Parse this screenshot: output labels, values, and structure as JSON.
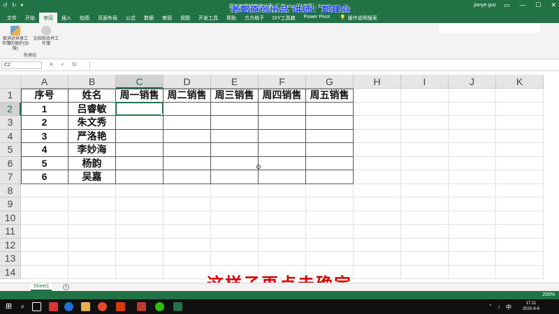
{
  "window": {
    "title": "周五每周销售统计表_汇总.xlsx [已共享] - Excel",
    "watermark": "老郭原创出品   讲师：郭建业",
    "user": "jianye guo",
    "quick_access": [
      "↺",
      "↻",
      "▾"
    ],
    "controls": [
      "▭",
      "—",
      "☐",
      "✕"
    ]
  },
  "ribbon": {
    "tabs": [
      "文件",
      "开始",
      "审阅",
      "插入",
      "绘图",
      "页面布局",
      "公式",
      "数据",
      "审阅",
      "视图",
      "开发工具",
      "帮助",
      "方方格子",
      "DIY工具箱",
      "Power Pivot"
    ],
    "active_tab_index": 2,
    "tell_me": "操作说明搜索",
    "buttons": [
      {
        "label": "取消对共享工作簿的保护(旧版)"
      },
      {
        "label": "比较和合并工作簿"
      }
    ],
    "group_label": "新建组"
  },
  "formula_bar": {
    "name_box": "C2",
    "buttons": [
      "✕",
      "✓",
      "fx"
    ],
    "value": ""
  },
  "sheet": {
    "columns": [
      "A",
      "B",
      "C",
      "D",
      "E",
      "F",
      "G",
      "H",
      "I",
      "J",
      "K"
    ],
    "rows": [
      "1",
      "2",
      "3",
      "4",
      "5",
      "6",
      "7",
      "8",
      "9",
      "10",
      "11",
      "12",
      "13",
      "14"
    ],
    "selected_cell": "C2",
    "header_row": [
      "序号",
      "姓名",
      "周一销售",
      "周二销售",
      "周三销售",
      "周四销售",
      "周五销售"
    ],
    "data_rows": [
      [
        "1",
        "吕睿敏",
        "",
        "",
        "",
        "",
        ""
      ],
      [
        "2",
        "朱文秀",
        "",
        "",
        "",
        "",
        ""
      ],
      [
        "3",
        "严洛艳",
        "",
        "",
        "",
        "",
        ""
      ],
      [
        "4",
        "李妙海",
        "",
        "",
        "",
        "",
        ""
      ],
      [
        "5",
        "杨韵",
        "",
        "",
        "",
        "",
        ""
      ],
      [
        "6",
        "吴嘉",
        "",
        "",
        "",
        "",
        ""
      ]
    ]
  },
  "sheet_tabs": {
    "tabs": [
      "Sheet1"
    ],
    "add": "+"
  },
  "subtitle": "这样子再点击确定",
  "status_bar": {
    "zoom": "205%"
  },
  "taskbar": {
    "ime": "中",
    "time": "17:11",
    "date": "2020-9-6"
  },
  "colors": {
    "excel_green": "#217346",
    "subtitle_red": "#d50000",
    "watermark_blue": "#1a3cff"
  }
}
